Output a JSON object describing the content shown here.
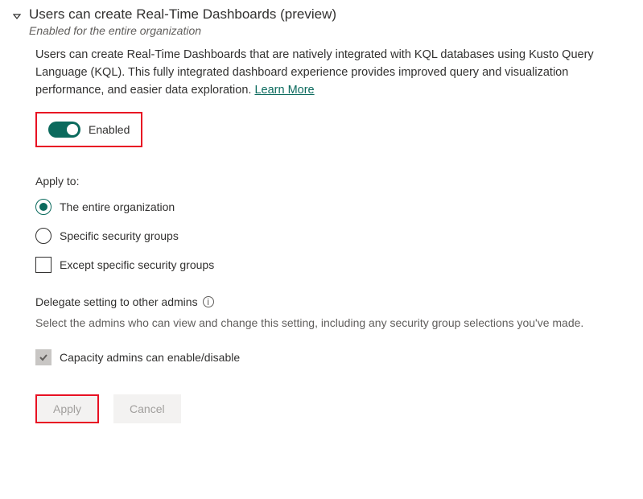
{
  "setting": {
    "title": "Users can create Real-Time Dashboards (preview)",
    "subtitle": "Enabled for the entire organization",
    "description": "Users can create Real-Time Dashboards that are natively integrated with KQL databases using Kusto Query Language (KQL). This fully integrated dashboard experience provides improved query and visualization performance, and easier data exploration. ",
    "learn_more": "Learn More",
    "toggle_label": "Enabled",
    "toggle_state": "on"
  },
  "apply_to": {
    "label": "Apply to:",
    "options": [
      {
        "label": "The entire organization",
        "selected": true
      },
      {
        "label": "Specific security groups",
        "selected": false
      }
    ],
    "except_label": "Except specific security groups",
    "except_checked": false
  },
  "delegate": {
    "label": "Delegate setting to other admins",
    "description": "Select the admins who can view and change this setting, including any security group selections you've made.",
    "capacity_label": "Capacity admins can enable/disable",
    "capacity_checked": true
  },
  "buttons": {
    "apply": "Apply",
    "cancel": "Cancel"
  }
}
